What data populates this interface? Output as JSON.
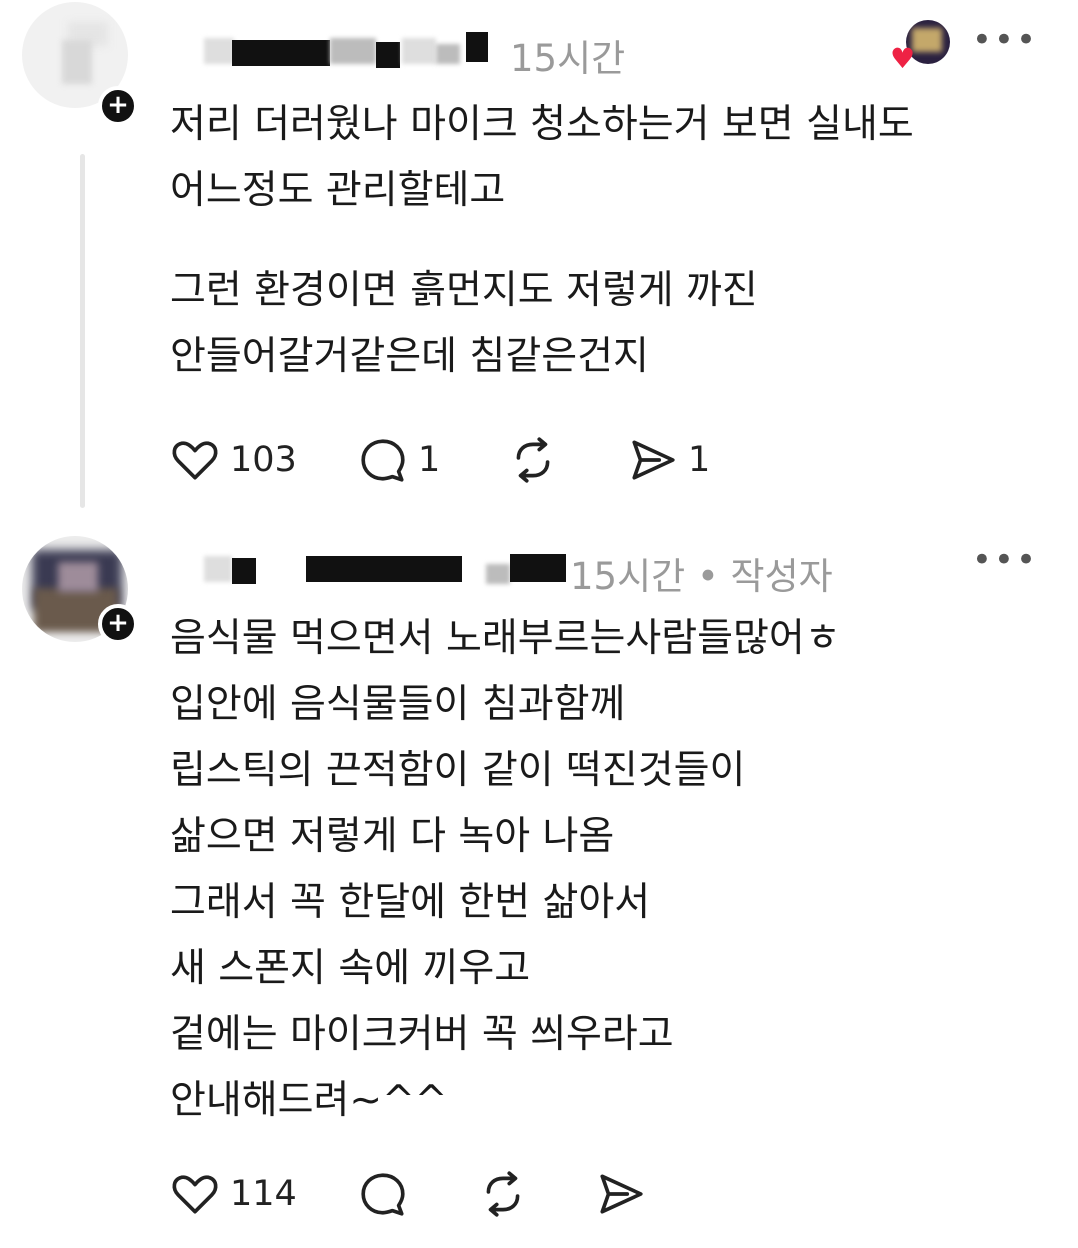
{
  "comments": [
    {
      "time": "15시간",
      "author_badge": "",
      "body_paragraphs": [
        [
          "저리 더러웠나 마이크 청소하는거 보면 실내도",
          "어느정도 관리할테고"
        ],
        [
          "그런 환경이면 흙먼지도 저렇게 까진",
          "안들어갈거같은데 침같은건지"
        ]
      ],
      "likes": "103",
      "replies": "1",
      "reposts": "",
      "shares": "1"
    },
    {
      "time": "15시간",
      "author_badge": "• 작성자",
      "body_lines": [
        "음식물 먹으면서 노래부르는사람들많어ㅎ",
        "입안에 음식물들이 침과함께",
        "립스틱의 끈적함이 같이 떡진것들이",
        "삶으면 저렇게 다 녹아 나옴",
        "그래서 꼭 한달에 한번 삶아서",
        "새 스폰지 속에 끼우고",
        "겉에는 마이크커버 꼭 씌우라고",
        "안내해드려~^^"
      ],
      "likes": "114",
      "replies": "",
      "reposts": "",
      "shares": ""
    }
  ],
  "icons": {
    "more": "more-horizontal-icon",
    "like": "heart-icon",
    "reply": "comment-icon",
    "repost": "repost-icon",
    "share": "send-icon",
    "follow": "plus-icon",
    "liked_badge": "heart-badge-icon"
  },
  "colors": {
    "text": "#1a1a1a",
    "meta": "#9a9a9a",
    "heart_badge": "#ee2244",
    "thread_line": "#e6e6e6"
  }
}
